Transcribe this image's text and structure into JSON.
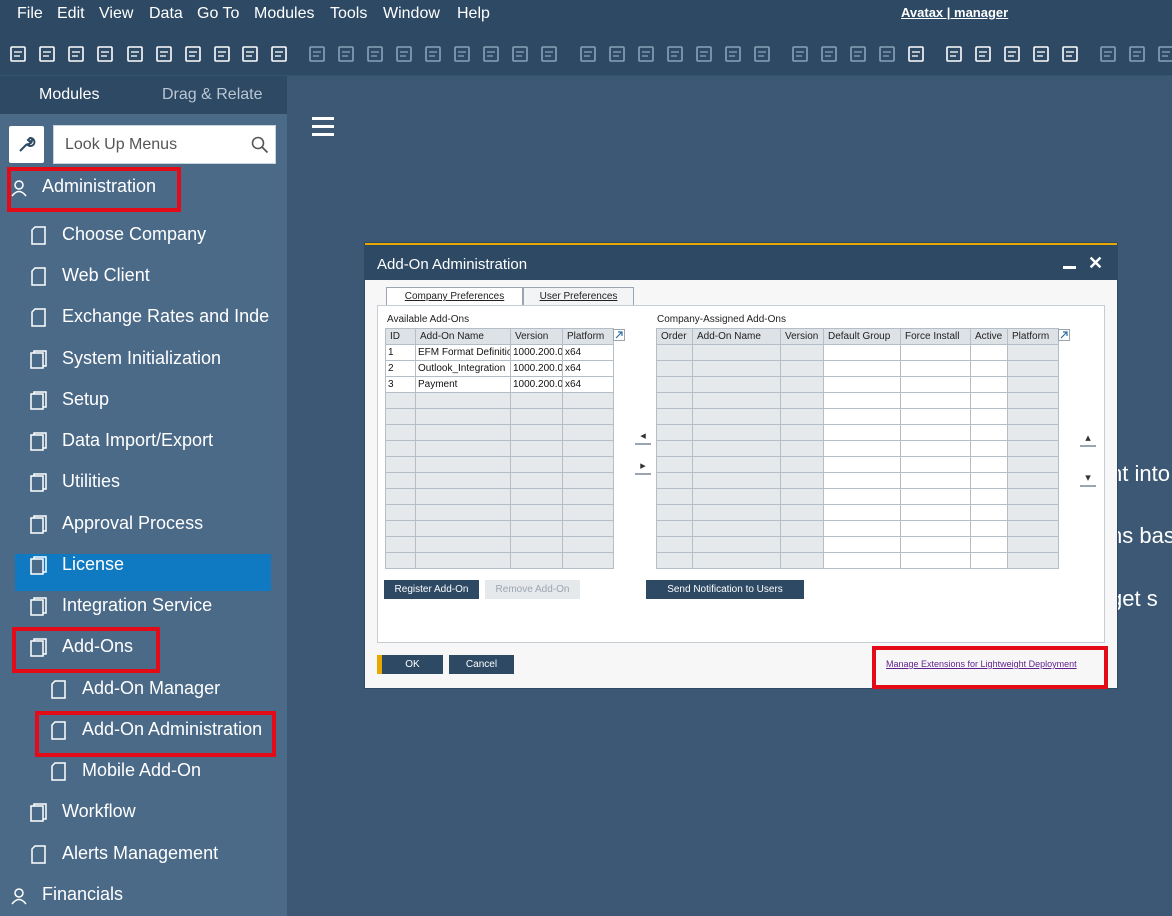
{
  "menubar": {
    "items": [
      "File",
      "Edit",
      "View",
      "Data",
      "Go To",
      "Modules",
      "Tools",
      "Window",
      "Help"
    ],
    "user_link": "Avatax | manager"
  },
  "toolbar": {
    "icons": [
      "print-preview-icon",
      "print-icon",
      "export-icon",
      "email-icon",
      "sms-icon",
      "excel-icon",
      "word-icon",
      "pdf-icon",
      "move-icon",
      "form-settings-icon",
      "group-icon",
      "open-icon",
      "first-record-icon",
      "previous-record-icon",
      "next-record-icon",
      "last-record-icon",
      "refresh-icon",
      "filter-icon",
      "sort-icon",
      "base-doc-icon",
      "target-doc-icon",
      "gross-profit-icon",
      "payment-means-icon",
      "volume-weight-icon",
      "freight-icon",
      "search-docs-icon",
      "edit-icon",
      "settings-icon",
      "document-icon",
      "message-icon",
      "alerts-icon",
      "lock-screen-icon",
      "info-icon",
      "calculator-icon",
      "users-icon",
      "stamp-icon",
      "copy-icon",
      "paste-icon",
      "close-window-icon"
    ]
  },
  "sidebar": {
    "tabs": [
      "Modules",
      "Drag & Relate"
    ],
    "search_placeholder": "Look Up Menus",
    "items": [
      {
        "label": "Administration",
        "level": 0,
        "icon": "admin-icon"
      },
      {
        "label": "Choose Company",
        "level": 1,
        "icon": "document-icon"
      },
      {
        "label": "Web Client",
        "level": 1,
        "icon": "document-icon"
      },
      {
        "label": "Exchange Rates and Inde",
        "level": 1,
        "icon": "document-icon"
      },
      {
        "label": "System Initialization",
        "level": 1,
        "icon": "folder-icon"
      },
      {
        "label": "Setup",
        "level": 1,
        "icon": "folder-icon"
      },
      {
        "label": "Data Import/Export",
        "level": 1,
        "icon": "folder-icon"
      },
      {
        "label": "Utilities",
        "level": 1,
        "icon": "folder-icon"
      },
      {
        "label": "Approval Process",
        "level": 1,
        "icon": "folder-icon"
      },
      {
        "label": "License",
        "level": 1,
        "icon": "folder-icon"
      },
      {
        "label": "Integration Service",
        "level": 1,
        "icon": "folder-icon"
      },
      {
        "label": "Add-Ons",
        "level": 1,
        "icon": "folder-icon"
      },
      {
        "label": "Add-On Manager",
        "level": 2,
        "icon": "document-icon"
      },
      {
        "label": "Add-On Administration",
        "level": 2,
        "icon": "document-icon"
      },
      {
        "label": "Mobile Add-On",
        "level": 2,
        "icon": "document-icon"
      },
      {
        "label": "Workflow",
        "level": 1,
        "icon": "folder-icon"
      },
      {
        "label": "Alerts Management",
        "level": 1,
        "icon": "document-icon"
      },
      {
        "label": "Financials",
        "level": 0,
        "icon": "financials-icon"
      }
    ]
  },
  "background_text": [
    "ht into",
    "ns bas",
    "get s"
  ],
  "dialog": {
    "title": "Add-On Administration",
    "tabs": [
      "Company Preferences",
      "User Preferences"
    ],
    "available": {
      "label": "Available Add-Ons",
      "columns": [
        "ID",
        "Add-On Name",
        "Version",
        "Platform"
      ],
      "rows": [
        [
          "1",
          "EFM Format Definitio",
          "1000.200.0(",
          "x64"
        ],
        [
          "2",
          "Outlook_Integration",
          "1000.200.0(",
          "x64"
        ],
        [
          "3",
          "Payment",
          "1000.200.0(",
          "x64"
        ]
      ]
    },
    "assigned": {
      "label": "Company-Assigned Add-Ons",
      "columns": [
        "Order",
        "Add-On Name",
        "Version",
        "Default Group",
        "Force Install",
        "Active",
        "Platform"
      ]
    },
    "buttons": {
      "register": "Register Add-On",
      "remove": "Remove Add-On",
      "send_notification": "Send Notification to Users",
      "ok": "OK",
      "cancel": "Cancel"
    },
    "manage_link": "Manage Extensions for Lightweight Deployment"
  }
}
